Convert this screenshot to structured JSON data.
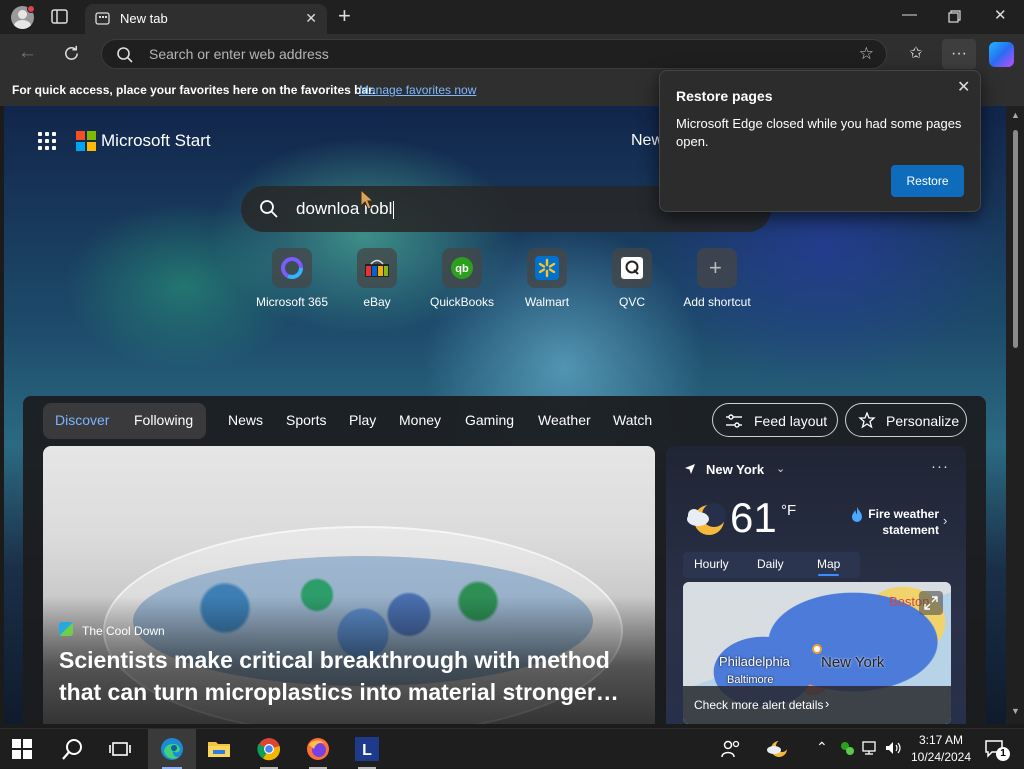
{
  "browser": {
    "tab_title": "New tab",
    "address_placeholder": "Search or enter web address"
  },
  "favorites_bar": {
    "text": "For quick access, place your favorites here on the favorites bar.",
    "link": "Manage favorites now"
  },
  "start": {
    "brand": "Microsoft Start",
    "news_peek": "New",
    "search_value": "downloa robl"
  },
  "shortcuts": [
    {
      "label": "Microsoft 365",
      "icon": "microsoft-365-icon"
    },
    {
      "label": "eBay",
      "icon": "ebay-icon"
    },
    {
      "label": "QuickBooks",
      "icon": "quickbooks-icon"
    },
    {
      "label": "Walmart",
      "icon": "walmart-icon"
    },
    {
      "label": "QVC",
      "icon": "qvc-icon"
    },
    {
      "label": "Add shortcut",
      "icon": "plus-icon"
    }
  ],
  "feed_nav": {
    "pills": [
      "Discover",
      "Following"
    ],
    "items": [
      "News",
      "Sports",
      "Play",
      "Money",
      "Gaming",
      "Weather",
      "Watch"
    ],
    "feed_layout": "Feed layout",
    "personalize": "Personalize"
  },
  "hero": {
    "source": "The Cool Down",
    "headline": "Scientists make critical breakthrough with method that can turn microplastics into material stronger…"
  },
  "weather": {
    "location": "New York",
    "temperature": "61",
    "unit": "°F",
    "alert": "Fire weather statement",
    "tabs": [
      "Hourly",
      "Daily",
      "Map"
    ],
    "active_tab": "Map",
    "map_labels": [
      "Boston",
      "Philadelphia",
      "New York",
      "Baltimore"
    ],
    "map_footer": "Check more alert details"
  },
  "restore_popup": {
    "title": "Restore pages",
    "message": "Microsoft Edge closed while you had some pages open.",
    "button": "Restore"
  },
  "taskbar": {
    "time": "3:17 AM",
    "date": "10/24/2024",
    "notification_count": "1"
  },
  "colors": {
    "accent": "#0f6cbd",
    "link": "#7cb8ff",
    "active_nav": "#7ab6ff"
  }
}
